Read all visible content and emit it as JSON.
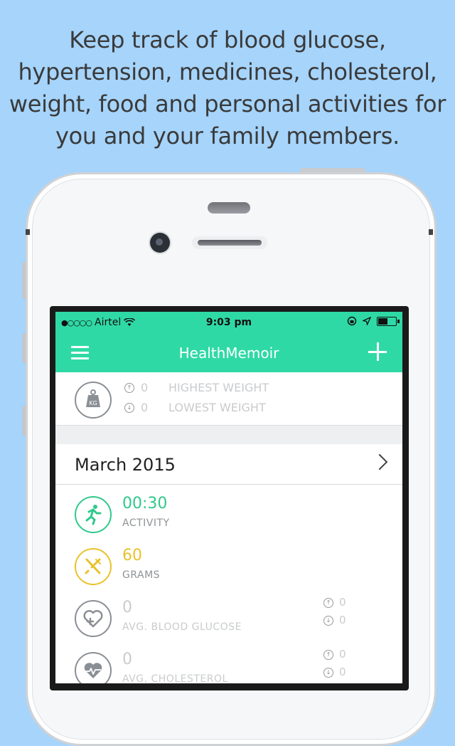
{
  "headline": {
    "lines": [
      "Keep track of blood glucose,",
      "hypertension, medicines, cholesterol,",
      "weight, food and personal activities for",
      "you and your family members."
    ]
  },
  "status_bar": {
    "carrier": "Airtel",
    "signal_dots": "●○○○○",
    "time": "9:03 pm"
  },
  "nav": {
    "title": "HealthMemoir",
    "menu_icon": "hamburger-menu-icon",
    "add_icon": "plus-icon"
  },
  "weight": {
    "icon_label": "KG",
    "highest_value": "0",
    "highest_label": "HIGHEST WEIGHT",
    "lowest_value": "0",
    "lowest_label": "LOWEST WEIGHT"
  },
  "month": {
    "label": "March 2015"
  },
  "metrics": [
    {
      "value": "00:30",
      "label": "ACTIVITY",
      "color": "#2fc98c",
      "icon": "running-person-icon"
    },
    {
      "value": "60",
      "label": "GRAMS",
      "color": "#e9c22b",
      "icon": "fork-knife-icon"
    },
    {
      "value": "0",
      "label": "AVG. BLOOD GLUCOSE",
      "color": "#c9cbcd",
      "icon": "heart-plus-icon",
      "up": "0",
      "down": "0"
    },
    {
      "value": "0",
      "label": "AVG. CHOLESTEROL",
      "color": "#c9cbcd",
      "icon": "heart-pulse-icon",
      "up": "0",
      "down": "0"
    }
  ],
  "colors": {
    "background": "#a6d4fb",
    "accent": "#2fd9a5"
  }
}
